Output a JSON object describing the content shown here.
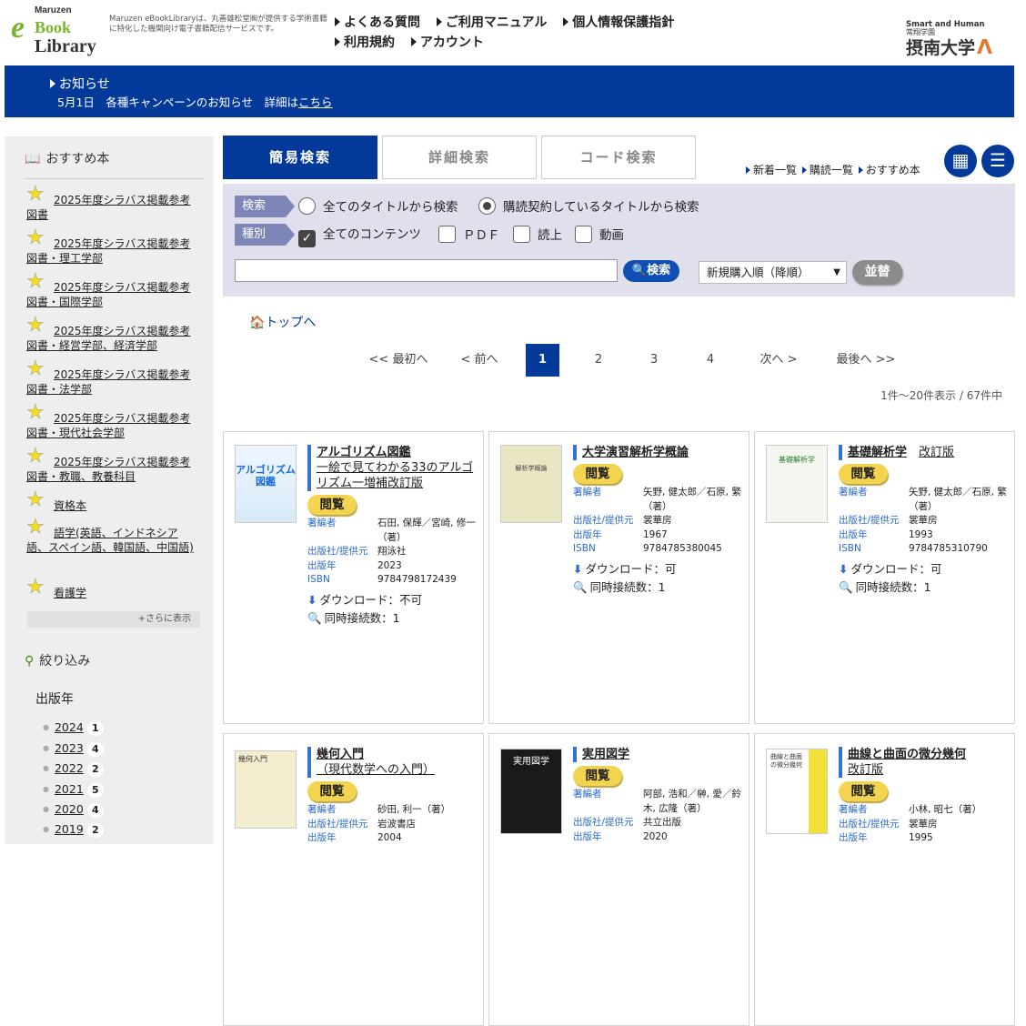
{
  "header": {
    "logo_top": "Maruzen",
    "logo_e": "e",
    "logo_book": "Book",
    "logo_library": "Library",
    "description": "Maruzen eBookLibraryは、丸善雄松堂㈱が提供する学術書籍に特化した機関向け電子書籍配信サービスです。",
    "nav": [
      "よくある質問",
      "ご利用マニュアル",
      "個人情報保護指針",
      "利用規約",
      "アカウント"
    ],
    "university_tag": "Smart and Human",
    "university_sub": "常翔学園",
    "university_name": "摂南大学",
    "university_mark": "ᐱ"
  },
  "notice": {
    "title": "お知らせ",
    "body": "5月1日　各種キャンペーンのお知らせ　詳細は",
    "link": "こちら"
  },
  "sidebar": {
    "heading": "おすすめ本",
    "items": [
      "2025年度シラバス掲載参考図書",
      "2025年度シラバス掲載参考図書・理工学部",
      "2025年度シラバス掲載参考図書・国際学部",
      "2025年度シラバス掲載参考図書・経営学部、経済学部",
      "2025年度シラバス掲載参考図書・法学部",
      "2025年度シラバス掲載参考図書・現代社会学部",
      "2025年度シラバス掲載参考図書・教職、教養科目",
      "資格本",
      "語学(英語、インドネシア語、スペイン語、韓国語、中国語)",
      "看護学"
    ],
    "more": "+さらに表示",
    "filter": "絞り込み",
    "year_heading": "出版年",
    "years": [
      {
        "year": "2024",
        "count": "1"
      },
      {
        "year": "2023",
        "count": "4"
      },
      {
        "year": "2022",
        "count": "2"
      },
      {
        "year": "2021",
        "count": "5"
      },
      {
        "year": "2020",
        "count": "4"
      },
      {
        "year": "2019",
        "count": "2"
      }
    ]
  },
  "tabs": [
    "簡易検索",
    "詳細検索",
    "コード検索"
  ],
  "links": [
    "新着一覧",
    "購読一覧",
    "おすすめ本"
  ],
  "search": {
    "label_search": "検索",
    "label_type": "種別",
    "radio_all": "全てのタイトルから検索",
    "radio_sub": "購読契約しているタイトルから検索",
    "chk_all": "全てのコンテンツ",
    "chk_pdf": "ＰＤＦ",
    "chk_read": "読上",
    "chk_video": "動画",
    "input_value": "",
    "button": "検索",
    "sort": "新規購入順（降順）",
    "sort_button": "並替"
  },
  "home": "トップへ",
  "pagination": [
    "<< 最初へ",
    "< 前へ",
    "1",
    "2",
    "3",
    "4",
    "次へ >",
    "最後へ >>"
  ],
  "count": "1件〜20件表示 / 67件中",
  "labels": {
    "view": "閲覧",
    "author": "著編者",
    "publisher": "出版社/提供元",
    "year": "出版年",
    "isbn": "ISBN",
    "download": "ダウンロード：",
    "concurrent": "同時接続数："
  },
  "books": [
    {
      "title": "アルゴリズム図鑑",
      "subtitle": "一絵で見てわかる33のアルゴリズム一増補改訂版",
      "author": "石田, 保輝／宮崎, 修一（著）",
      "publisher": "翔泳社",
      "year": "2023",
      "isbn": "9784798172439",
      "download": "不可",
      "concurrent": "1",
      "cover_text": "アルゴリズム図鑑"
    },
    {
      "title": "大学演習解析学概論",
      "subtitle": "",
      "author": "矢野, 健太郎／石原, 繁（著）",
      "publisher": "裳華房",
      "year": "1967",
      "isbn": "9784785380045",
      "download": "可",
      "concurrent": "1",
      "cover_text": "解析学概論"
    },
    {
      "title": "基礎解析学",
      "subtitle": "改訂版",
      "author": "矢野, 健太郎／石原, 繁（著）",
      "publisher": "裳華房",
      "year": "1993",
      "isbn": "9784785310790",
      "download": "可",
      "concurrent": "1",
      "cover_text": "基礎解析学"
    },
    {
      "title": "幾何入門",
      "subtitle": "（現代数学への入門）",
      "author": "砂田, 利一（著）",
      "publisher": "岩波書店",
      "year": "2004",
      "cover_text": "幾何入門"
    },
    {
      "title": "実用図学",
      "subtitle": "",
      "author": "阿部, 浩和／榊, 愛／鈴木, 広隆（著）",
      "publisher": "共立出版",
      "year": "2020",
      "cover_text": "実用図学"
    },
    {
      "title": "曲線と曲面の微分幾何",
      "subtitle": "改訂版",
      "author": "小林, 昭七（著）",
      "publisher": "裳華房",
      "year": "1995",
      "cover_text": "曲線と曲面の微分幾何"
    }
  ]
}
